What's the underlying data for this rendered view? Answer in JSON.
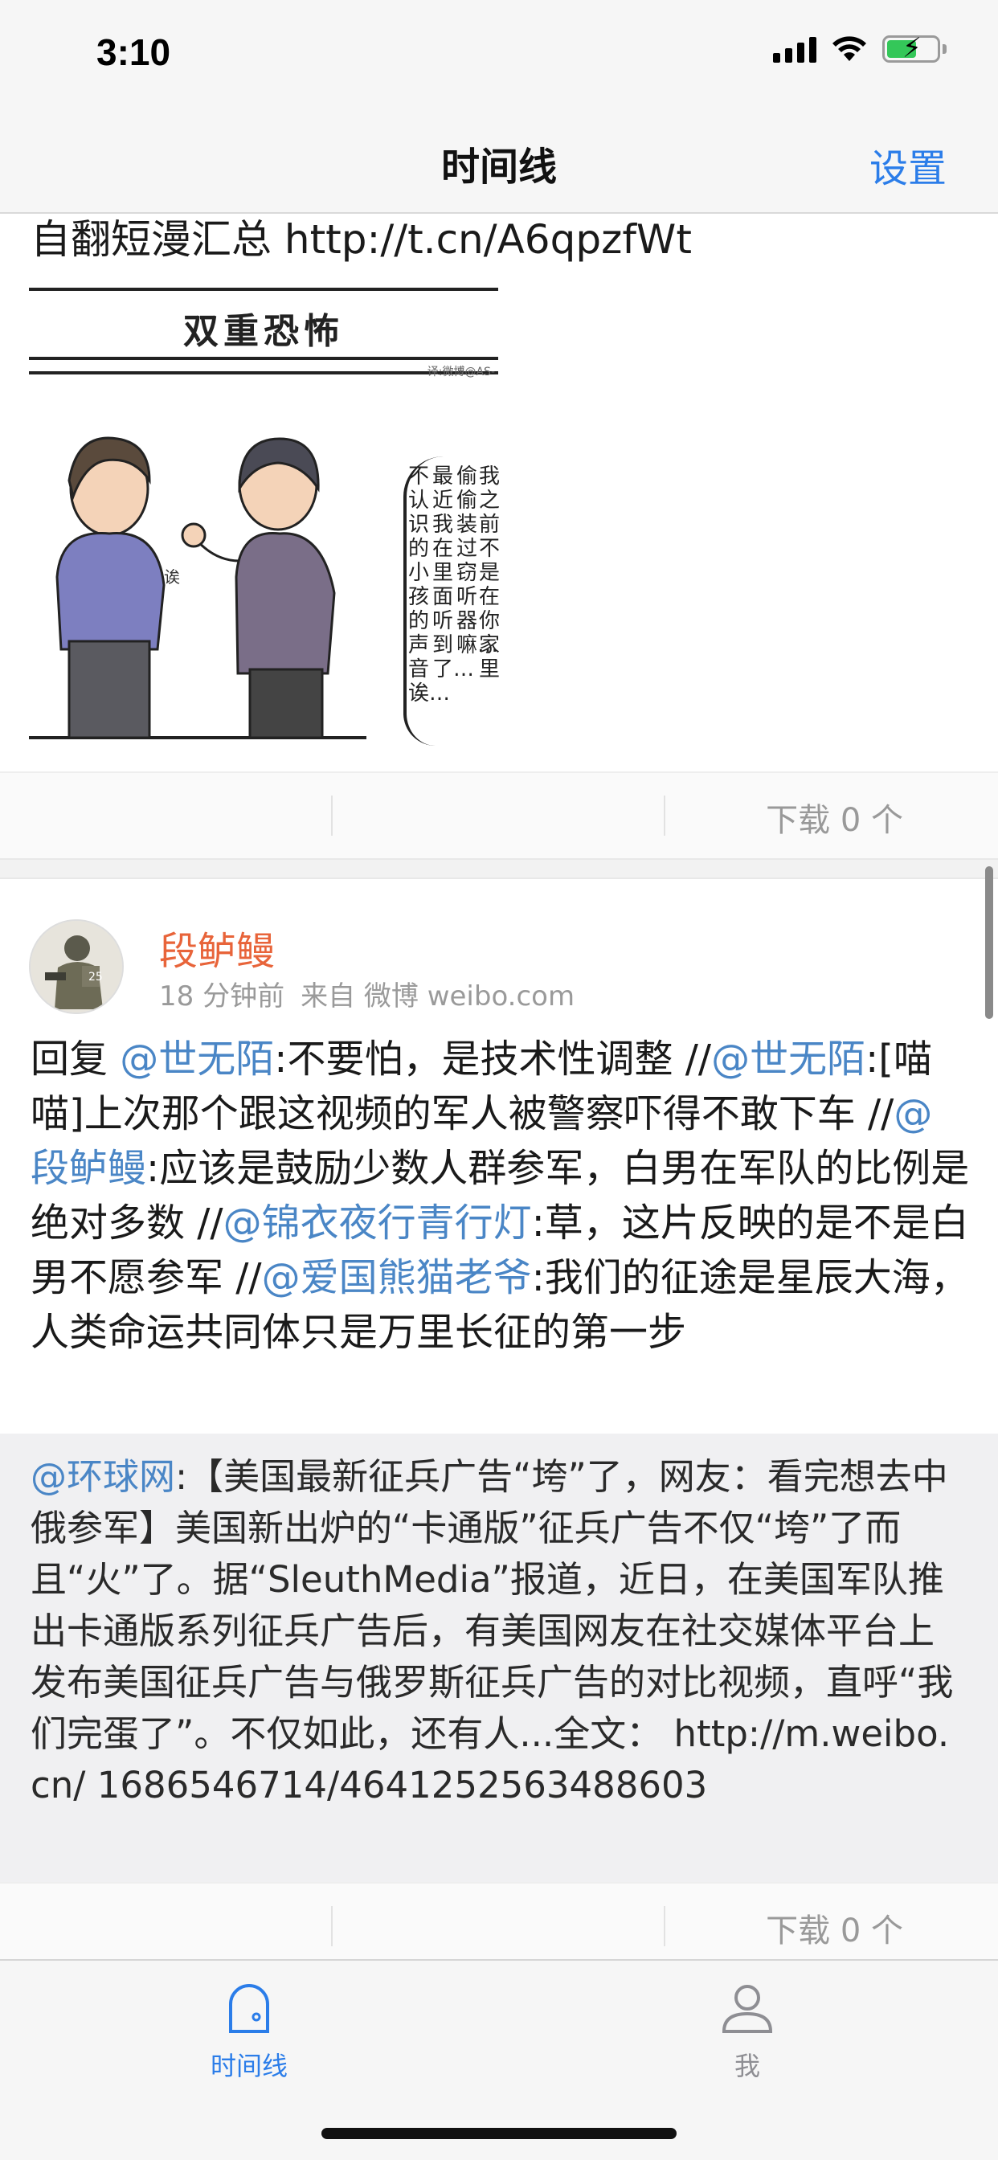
{
  "status_bar": {
    "time": "3:10"
  },
  "nav": {
    "title": "时间线",
    "settings_label": "设置"
  },
  "feed": {
    "top_post": {
      "text": "自翻短漫汇总 http://t.cn/A6qpzfWt",
      "comic": {
        "title": "双重恐怖",
        "credit": "译:微博@AS-",
        "sigh": "诶",
        "speech_columns": [
          "不认识的小孩的声音诶…",
          "最近我在里面听到了…",
          "偷偷装过窃听器嘛…",
          "我之前不是在你家里"
        ]
      },
      "download_label": "下载 0 个"
    },
    "post": {
      "author": "段鲈鳗",
      "time": "18 分钟前",
      "source": "来自 微博 weibo.com",
      "body": [
        {
          "t": "回复 "
        },
        {
          "m": "@世无陌"
        },
        {
          "t": ":不要怕，是技术性调整 //"
        },
        {
          "m": "@世无陌"
        },
        {
          "t": ":[喵喵]上次那个跟这视频的军人被警察吓得不敢下车 //"
        },
        {
          "m": "@段鲈鳗"
        },
        {
          "t": ":应该是鼓励少数人群参军，白男在军队的比例是绝对多数 //"
        },
        {
          "m": "@锦衣夜行青行灯"
        },
        {
          "t": ":草，这片反映的是不是白男不愿参军 //"
        },
        {
          "m": "@爱国熊猫老爷"
        },
        {
          "t": ":我们的征途是星辰大海，人类命运共同体只是万里长征的第一步"
        }
      ],
      "retweet": {
        "mention": "@环球网",
        "text": ":【美国最新征兵广告“垮”了，网友：看完想去中俄参军】美国新出炉的“卡通版”征兵广告不仅“垮”了而且“火”了。据“SleuthMedia”报道，近日，在美国军队推出卡通版系列征兵广告后，有美国网友在社交媒体平台上发布美国征兵广告与俄罗斯征兵广告的对比视频，直呼“我们完蛋了”。不仅如此，还有人...全文： http://m.weibo.cn/ 1686546714/4641252563488603"
      },
      "download_label": "下载 0 个"
    }
  },
  "tab_bar": {
    "tabs": [
      {
        "label": "时间线",
        "icon": "timeline-icon",
        "active": true
      },
      {
        "label": "我",
        "icon": "person-icon",
        "active": false
      }
    ]
  },
  "colors": {
    "accent": "#2b7de9",
    "author": "#e8643a",
    "mention": "#4a86c6"
  }
}
